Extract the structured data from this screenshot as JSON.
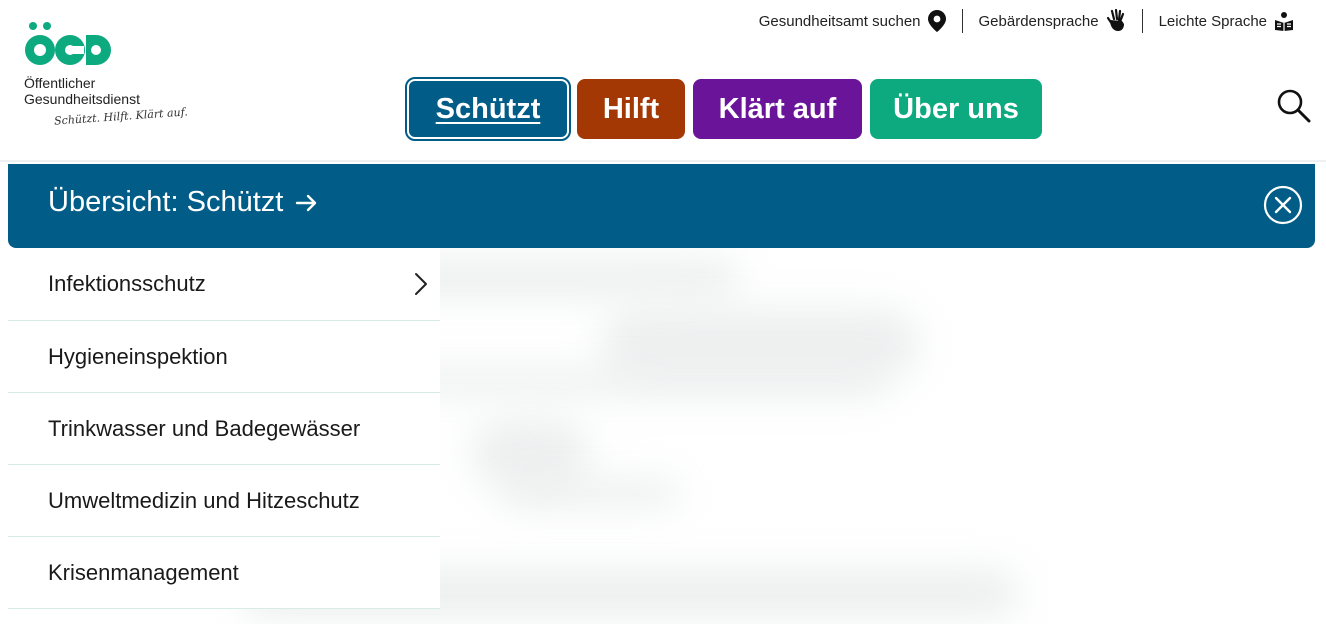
{
  "logo": {
    "mark_text": "ÖGD",
    "line1": "Öffentlicher",
    "line2": "Gesundheitsdienst",
    "slogan": "Schützt. Hilft. Klärt auf."
  },
  "utility": [
    {
      "label": "Gesundheitsamt suchen",
      "icon": "location-pin-icon"
    },
    {
      "label": "Gebärdensprache",
      "icon": "sign-language-icon"
    },
    {
      "label": "Leichte Sprache",
      "icon": "easy-language-icon"
    }
  ],
  "nav": [
    {
      "label": "Schützt",
      "color": "#015d87",
      "active": true
    },
    {
      "label": "Hilft",
      "color": "#a33804"
    },
    {
      "label": "Klärt auf",
      "color": "#6a149a"
    },
    {
      "label": "Über uns",
      "color": "#0daa7f"
    }
  ],
  "overview": {
    "label": "Übersicht: Schützt"
  },
  "menu": [
    {
      "label": "Infektionsschutz",
      "has_submenu": true
    },
    {
      "label": "Hygieneinspektion"
    },
    {
      "label": "Trinkwasser und Badegewässer"
    },
    {
      "label": "Umweltmedizin und Hitzeschutz"
    },
    {
      "label": "Krisenmanagement"
    }
  ]
}
